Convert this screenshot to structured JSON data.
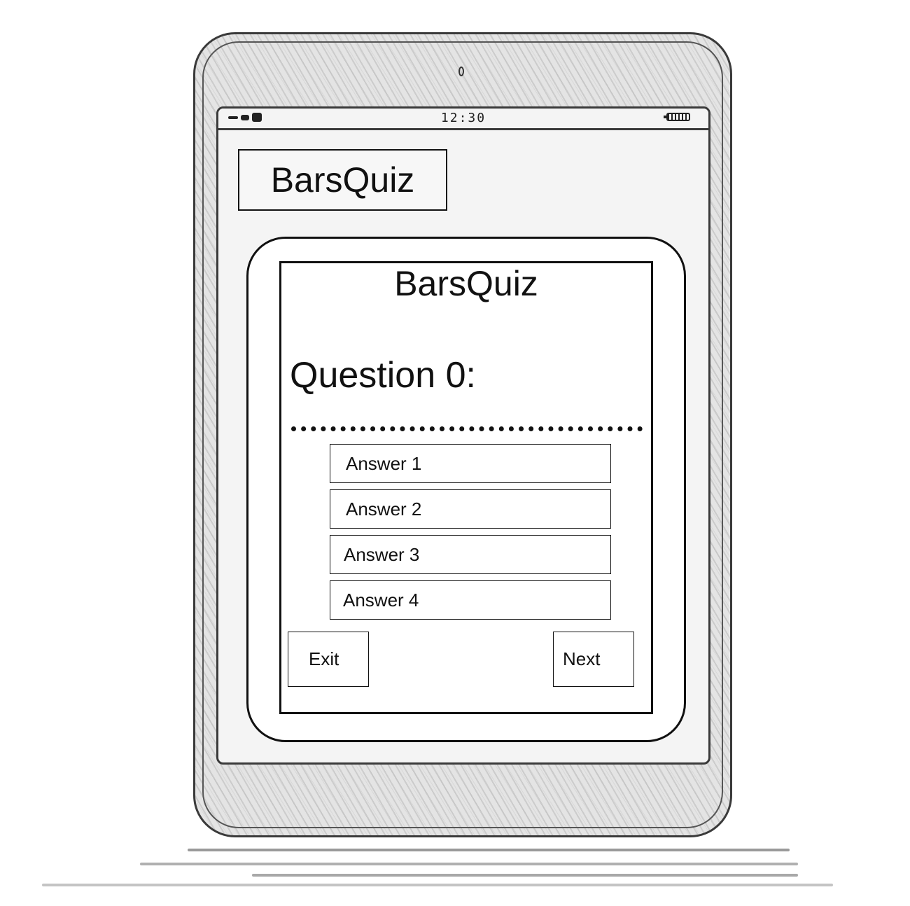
{
  "status_bar": {
    "time": "12:30"
  },
  "header": {
    "app_title": "BarsQuiz"
  },
  "quiz": {
    "title": "BarsQuiz",
    "question": "Question 0:",
    "answers": [
      {
        "label": "Answer 1"
      },
      {
        "label": "Answer 2"
      },
      {
        "label": "Answer 3"
      },
      {
        "label": "Answer 4"
      }
    ],
    "exit_label": "Exit",
    "next_label": "Next"
  },
  "icons": {
    "signal": "signal-strength-icon",
    "battery": "battery-icon",
    "camera": "front-camera-icon"
  }
}
